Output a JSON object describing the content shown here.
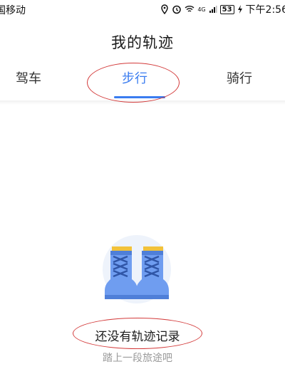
{
  "status_bar": {
    "carrier": "国移动",
    "network": "4G",
    "battery": "53",
    "time": "下午2:56"
  },
  "page": {
    "title": "我的轨迹"
  },
  "tabs": [
    {
      "label": "驾车",
      "selected": false
    },
    {
      "label": "步行",
      "selected": true
    },
    {
      "label": "骑行",
      "selected": false
    }
  ],
  "empty_state": {
    "title": "还没有轨迹记录",
    "subtitle": "踏上一段旅途吧",
    "illustration": "hiking-boots-icon"
  },
  "colors": {
    "accent": "#3a7cf0",
    "annotation": "#d33a3a"
  }
}
